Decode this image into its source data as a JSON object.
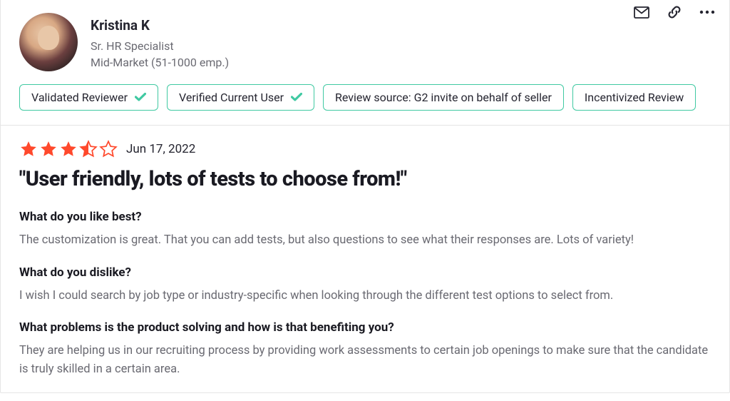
{
  "reviewer": {
    "name": "Kristina K",
    "title": "Sr. HR Specialist",
    "segment": "Mid-Market (51-1000 emp.)"
  },
  "badges": {
    "validated": "Validated Reviewer",
    "verified": "Verified Current User",
    "source": "Review source: G2 invite on behalf of seller",
    "incentivized": "Incentivized Review"
  },
  "review": {
    "rating": 3.5,
    "date": "Jun 17, 2022",
    "title": "\"User friendly, lots of tests to choose from!\"",
    "qa": [
      {
        "q": "What do you like best?",
        "a": "The customization is great. That you can add tests, but also questions to see what their responses are. Lots of variety!"
      },
      {
        "q": "What do you dislike?",
        "a": "I wish I could search by job type or industry-specific when looking through the different test options to select from."
      },
      {
        "q": "What problems is the product solving and how is that benefiting you?",
        "a": "They are helping us in our recruiting process by providing work assessments to certain job openings to make sure that the candidate is truly skilled in a certain area."
      }
    ]
  },
  "colors": {
    "star": "#ff492c",
    "badgeBorder": "#40c9a2"
  }
}
